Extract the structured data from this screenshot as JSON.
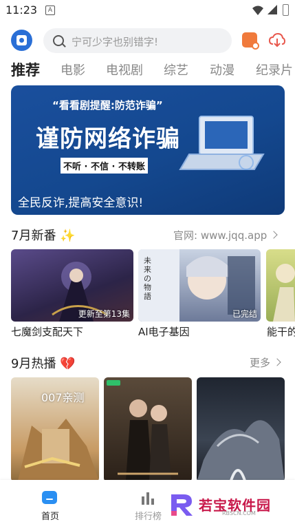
{
  "status_bar": {
    "time": "11:23",
    "notification_glyph": "A"
  },
  "header": {
    "search_placeholder": "宁可少字也别错字!"
  },
  "tabs": [
    "推荐",
    "电影",
    "电视剧",
    "综艺",
    "动漫",
    "纪录片"
  ],
  "banner": {
    "top_line": "“看看剧提醒:防范诈骗”",
    "title": "谨防网络诈骗",
    "slogan": "不听 · 不信 · 不转账",
    "caption": "全民反诈,提高安全意识!"
  },
  "section_new": {
    "title": "7月新番",
    "title_icon": "sparkles-icon",
    "more": "官网: www.jqq.app",
    "items": [
      {
        "name": "七魔剑支配天下",
        "badge": "更新至第13集",
        "bg": "#3a2f5c"
      },
      {
        "name": "AI电子基因",
        "badge": "已完结",
        "bg": "#8a8fa8",
        "poster_text": "未来の物語"
      },
      {
        "name": "能干的",
        "badge": "",
        "bg": "#b7c46a"
      }
    ]
  },
  "section_hot": {
    "title": "9月热播",
    "title_icon": "broken-heart-icon",
    "more": "更多",
    "items": [
      {
        "overlay": "007亲测",
        "bg": "#c9a66b"
      },
      {
        "overlay": "",
        "bg": "#3c2e22"
      },
      {
        "overlay": "",
        "bg": "#2a2f3a"
      }
    ]
  },
  "bottom_nav": [
    {
      "label": "首页",
      "icon": "home-icon",
      "active": true
    },
    {
      "label": "排行榜",
      "icon": "rank-icon",
      "active": false
    }
  ],
  "watermark": {
    "text": "若宝软件园",
    "sub": "RBSCN.COM"
  },
  "colors": {
    "accent": "#2a8ff2",
    "banner": "#1a4f9d",
    "watermark": "#c8184a"
  }
}
